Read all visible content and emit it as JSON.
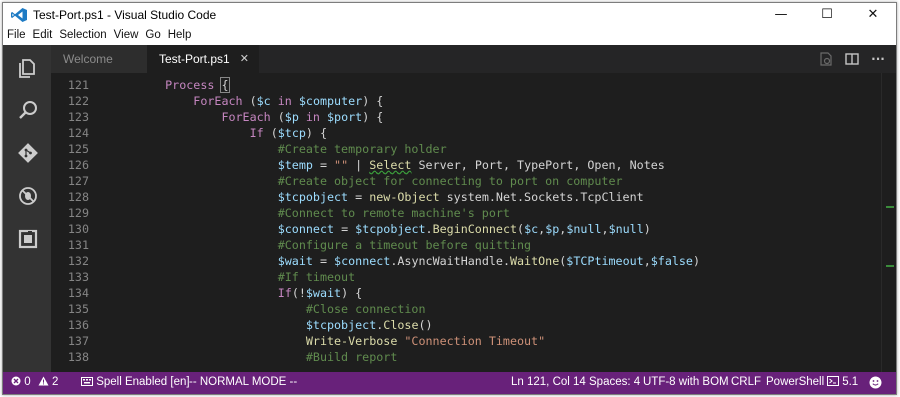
{
  "window": {
    "title": "Test-Port.ps1 - Visual Studio Code"
  },
  "window_controls": {
    "minimize": "—",
    "maximize": "☐",
    "close": "✕"
  },
  "menu": [
    "File",
    "Edit",
    "Selection",
    "View",
    "Go",
    "Help"
  ],
  "activity": [
    "explorer-icon",
    "search-icon",
    "git-icon",
    "debug-icon",
    "extensions-icon"
  ],
  "tabs": [
    {
      "label": "Welcome",
      "active": false
    },
    {
      "label": "Test-Port.ps1",
      "active": true,
      "close": "✕"
    }
  ],
  "tab_actions": {
    "more": "···"
  },
  "editor": {
    "lines": [
      {
        "n": "121",
        "t": [
          [
            "kw",
            "    Process "
          ],
          [
            "op",
            "{"
          ]
        ]
      },
      {
        "n": "122",
        "t": [
          [
            "kw",
            "        ForEach "
          ],
          [
            "op",
            "("
          ],
          [
            "var",
            "$c"
          ],
          [
            "kw",
            " in "
          ],
          [
            "var",
            "$computer"
          ],
          [
            "op",
            ") {"
          ]
        ]
      },
      {
        "n": "123",
        "t": [
          [
            "kw",
            "            ForEach "
          ],
          [
            "op",
            "("
          ],
          [
            "var",
            "$p"
          ],
          [
            "kw",
            " in "
          ],
          [
            "var",
            "$port"
          ],
          [
            "op",
            ") {"
          ]
        ]
      },
      {
        "n": "124",
        "t": [
          [
            "kw",
            "                If "
          ],
          [
            "op",
            "("
          ],
          [
            "var",
            "$tcp"
          ],
          [
            "op",
            ") {"
          ]
        ]
      },
      {
        "n": "125",
        "t": [
          [
            "cmt",
            "                    #Create temporary holder"
          ]
        ]
      },
      {
        "n": "126",
        "t": [
          [
            "var",
            "                    $temp"
          ],
          [
            "op",
            " = "
          ],
          [
            "str",
            "\"\""
          ],
          [
            "op",
            " | "
          ],
          [
            "fn",
            "Select"
          ],
          [
            "txt",
            " Server, Port, TypePort, Open, Notes"
          ]
        ]
      },
      {
        "n": "127",
        "t": [
          [
            "cmt",
            "                    #Create object for connecting to port on computer"
          ]
        ]
      },
      {
        "n": "128",
        "t": [
          [
            "var",
            "                    $tcpobject"
          ],
          [
            "op",
            " = "
          ],
          [
            "fn",
            "new-Object"
          ],
          [
            "txt",
            " system.Net.Sockets.TcpClient"
          ]
        ]
      },
      {
        "n": "129",
        "t": [
          [
            "cmt",
            "                    #Connect to remote machine's port"
          ]
        ]
      },
      {
        "n": "130",
        "t": [
          [
            "var",
            "                    $connect"
          ],
          [
            "op",
            " = "
          ],
          [
            "var",
            "$tcpobject"
          ],
          [
            "op",
            "."
          ],
          [
            "fn",
            "BeginConnect"
          ],
          [
            "op",
            "("
          ],
          [
            "var",
            "$c"
          ],
          [
            "op",
            ","
          ],
          [
            "var",
            "$p"
          ],
          [
            "op",
            ","
          ],
          [
            "var",
            "$null"
          ],
          [
            "op",
            ","
          ],
          [
            "var",
            "$null"
          ],
          [
            "op",
            ")"
          ]
        ]
      },
      {
        "n": "131",
        "t": [
          [
            "cmt",
            "                    #Configure a timeout before quitting"
          ]
        ]
      },
      {
        "n": "132",
        "t": [
          [
            "var",
            "                    $wait"
          ],
          [
            "op",
            " = "
          ],
          [
            "var",
            "$connect"
          ],
          [
            "op",
            "."
          ],
          [
            "txt",
            "AsyncWaitHandle."
          ],
          [
            "fn",
            "WaitOne"
          ],
          [
            "op",
            "("
          ],
          [
            "var",
            "$TCPtimeout"
          ],
          [
            "op",
            ","
          ],
          [
            "var",
            "$false"
          ],
          [
            "op",
            ")"
          ]
        ]
      },
      {
        "n": "133",
        "t": [
          [
            "cmt",
            "                    #If timeout"
          ]
        ]
      },
      {
        "n": "134",
        "t": [
          [
            "kw",
            "                    If"
          ],
          [
            "op",
            "(!"
          ],
          [
            "var",
            "$wait"
          ],
          [
            "op",
            ") {"
          ]
        ]
      },
      {
        "n": "135",
        "t": [
          [
            "cmt",
            "                        #Close connection"
          ]
        ]
      },
      {
        "n": "136",
        "t": [
          [
            "var",
            "                        $tcpobject"
          ],
          [
            "op",
            "."
          ],
          [
            "fn",
            "Close"
          ],
          [
            "op",
            "()"
          ]
        ]
      },
      {
        "n": "137",
        "t": [
          [
            "fn",
            "                        Write-Verbose"
          ],
          [
            "str",
            " \"Connection Timeout\""
          ]
        ]
      },
      {
        "n": "138",
        "t": [
          [
            "cmt",
            "                        #Build report"
          ]
        ]
      }
    ]
  },
  "statusbar": {
    "errors": "0",
    "warnings": "2",
    "spell": "Spell Enabled [en]",
    "mode": "-- NORMAL MODE --",
    "position": "Ln 121, Col 14",
    "spaces": "Spaces: 4",
    "encoding": "UTF-8 with BOM",
    "eol": "CRLF",
    "language": "PowerShell",
    "version": "5.1"
  },
  "colors": {
    "statusbar": "#68217a",
    "editor_bg": "#1e1e1e",
    "activitybar": "#333333"
  }
}
